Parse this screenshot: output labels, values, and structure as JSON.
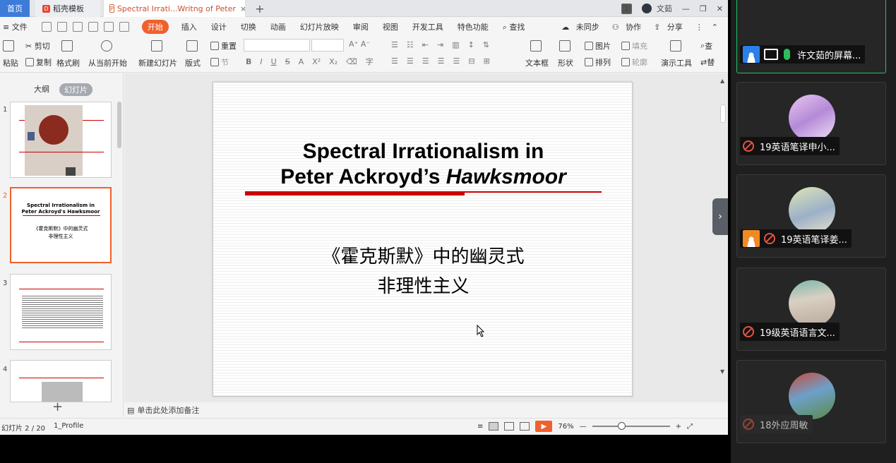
{
  "tabs": {
    "home": "首页",
    "template": "稻壳模板",
    "document": "Spectral Irrati...Writng of Peter"
  },
  "window": {
    "badge": "1",
    "user": "文茹"
  },
  "menu": {
    "file": "文件",
    "items": [
      "开始",
      "插入",
      "设计",
      "切换",
      "动画",
      "幻灯片放映",
      "审阅",
      "视图",
      "开发工具",
      "特色功能"
    ],
    "search": "查找",
    "sync": "未同步",
    "collab": "协作",
    "share": "分享"
  },
  "ribbon": {
    "paste": "粘贴",
    "cut": "剪切",
    "copy": "复制",
    "format_painter": "格式刷",
    "from_current": "从当前开始",
    "new_slide": "新建幻灯片",
    "layout": "版式",
    "reset": "重置",
    "section": "节",
    "textbox": "文本框",
    "shape": "形状",
    "picture": "图片",
    "fill": "填充",
    "arrange": "排列",
    "outline": "轮廓",
    "presentation_tools": "演示工具",
    "find": "查",
    "replace": "替"
  },
  "panel": {
    "outline": "大纲",
    "slides": "幻灯片",
    "slide_numbers": [
      "1",
      "2",
      "3",
      "4"
    ],
    "thumb2_title_1": "Spectral Irrationalism in",
    "thumb2_title_2": "Peter Ackroyd's Hawksmoor",
    "thumb2_sub_1": "《霍克斯默》中的幽灵式",
    "thumb2_sub_2": "非理性主义"
  },
  "slide": {
    "title_line1": "Spectral Irrationalism in",
    "title_line2_prefix": "Peter Ackroyd’s ",
    "title_line2_italic": "Hawksmoor",
    "subtitle_line1": "《霍克斯默》中的幽灵式",
    "subtitle_line2": "非理性主义"
  },
  "notes_placeholder": "单击此处添加备注",
  "status": {
    "slide_info": "幻灯片 2 / 20",
    "theme": "1_Profile",
    "zoom": "76%",
    "zoom_fraction": 0.38
  },
  "participants": [
    {
      "name": "许文茹的屏幕...",
      "state": "sharing"
    },
    {
      "name": "19英语笔译申小...",
      "state": "muted"
    },
    {
      "name": "19英语笔译姜...",
      "state": "muted"
    },
    {
      "name": "19级英语语言文...",
      "state": "muted"
    },
    {
      "name": "18外应周敏",
      "state": "muted"
    }
  ],
  "colors": {
    "accent": "#f0602d",
    "active_tab": "#3d7bd8",
    "title_rule": "#cc0000",
    "speaking_border": "#22c466"
  }
}
